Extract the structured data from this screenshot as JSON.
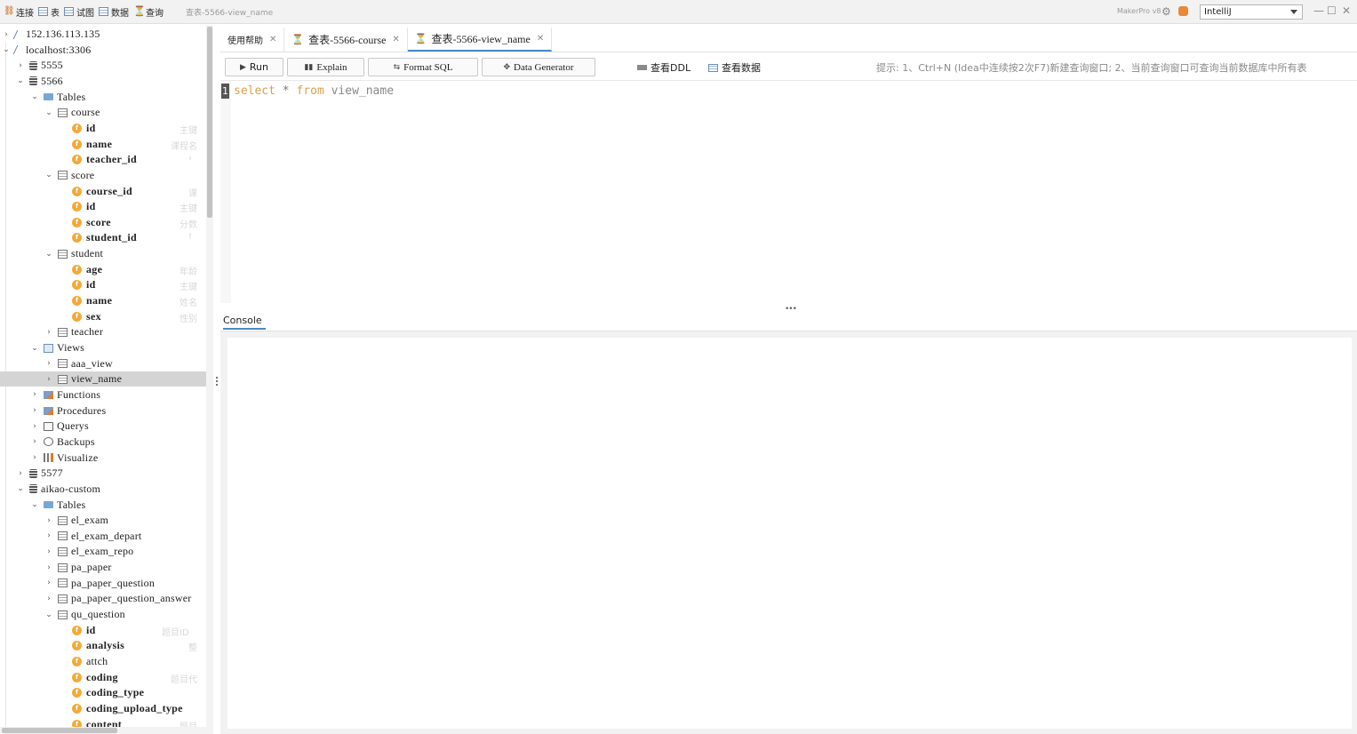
{
  "topbar": {
    "items": [
      {
        "label": "连接",
        "icon": "connect-icon"
      },
      {
        "label": "表",
        "icon": "table-icon"
      },
      {
        "label": "试图",
        "icon": "view-icon"
      },
      {
        "label": "数据",
        "icon": "data-icon"
      },
      {
        "label": "查询",
        "icon": "query-icon"
      }
    ],
    "window_title": "查表-5566-view_name",
    "brand": "MakerPro v8",
    "theme": "IntelliJ",
    "minimize": "—",
    "maximize": "☐",
    "close": "✕"
  },
  "tree": {
    "nodes": [
      {
        "depth": 0,
        "chev": "›",
        "icon": "server",
        "label": "152.136.113.135",
        "kind": "tname"
      },
      {
        "depth": 0,
        "chev": "⌄",
        "icon": "server",
        "label": "localhost:3306",
        "kind": "tname"
      },
      {
        "depth": 1,
        "chev": "›",
        "icon": "db",
        "label": "5555",
        "kind": "tname"
      },
      {
        "depth": 1,
        "chev": "⌄",
        "icon": "db",
        "label": "5566",
        "kind": "tname"
      },
      {
        "depth": 2,
        "chev": "⌄",
        "icon": "folder",
        "label": "Tables",
        "kind": "tname"
      },
      {
        "depth": 3,
        "chev": "⌄",
        "icon": "table",
        "label": "course",
        "kind": "tname"
      },
      {
        "depth": 4,
        "chev": "",
        "icon": "field",
        "label": "id",
        "kind": "fname",
        "comment": "主键"
      },
      {
        "depth": 4,
        "chev": "",
        "icon": "field",
        "label": "name",
        "kind": "fname",
        "comment": "课程名"
      },
      {
        "depth": 4,
        "chev": "",
        "icon": "field",
        "label": "teacher_id",
        "kind": "fname",
        "comment": "‹"
      },
      {
        "depth": 3,
        "chev": "⌄",
        "icon": "table",
        "label": "score",
        "kind": "tname"
      },
      {
        "depth": 4,
        "chev": "",
        "icon": "field",
        "label": "course_id",
        "kind": "fname",
        "comment": "课"
      },
      {
        "depth": 4,
        "chev": "",
        "icon": "field",
        "label": "id",
        "kind": "fname",
        "comment": "主键"
      },
      {
        "depth": 4,
        "chev": "",
        "icon": "field",
        "label": "score",
        "kind": "fname",
        "comment": "分数"
      },
      {
        "depth": 4,
        "chev": "",
        "icon": "field",
        "label": "student_id",
        "kind": "fname",
        "comment": "!"
      },
      {
        "depth": 3,
        "chev": "⌄",
        "icon": "table",
        "label": "student",
        "kind": "tname"
      },
      {
        "depth": 4,
        "chev": "",
        "icon": "field",
        "label": "age",
        "kind": "fname",
        "comment": "年龄"
      },
      {
        "depth": 4,
        "chev": "",
        "icon": "field",
        "label": "id",
        "kind": "fname",
        "comment": "主键"
      },
      {
        "depth": 4,
        "chev": "",
        "icon": "field",
        "label": "name",
        "kind": "fname",
        "comment": "姓名"
      },
      {
        "depth": 4,
        "chev": "",
        "icon": "field",
        "label": "sex",
        "kind": "fname",
        "comment": "性别"
      },
      {
        "depth": 3,
        "chev": "›",
        "icon": "table",
        "label": "teacher",
        "kind": "tname"
      },
      {
        "depth": 2,
        "chev": "⌄",
        "icon": "view",
        "label": "Views",
        "kind": "tname"
      },
      {
        "depth": 3,
        "chev": "›",
        "icon": "table",
        "label": "aaa_view",
        "kind": "tname"
      },
      {
        "depth": 3,
        "chev": "›",
        "icon": "table",
        "label": "view_name",
        "kind": "tname",
        "selected": true
      },
      {
        "depth": 2,
        "chev": "›",
        "icon": "func",
        "label": "Functions",
        "kind": "tname"
      },
      {
        "depth": 2,
        "chev": "›",
        "icon": "func",
        "label": "Procedures",
        "kind": "tname"
      },
      {
        "depth": 2,
        "chev": "›",
        "icon": "query",
        "label": "Querys",
        "kind": "tname"
      },
      {
        "depth": 2,
        "chev": "›",
        "icon": "backup",
        "label": "Backups",
        "kind": "tname"
      },
      {
        "depth": 2,
        "chev": "›",
        "icon": "vis",
        "label": "Visualize",
        "kind": "tname"
      },
      {
        "depth": 1,
        "chev": "›",
        "icon": "db",
        "label": "5577",
        "kind": "tname"
      },
      {
        "depth": 1,
        "chev": "⌄",
        "icon": "db",
        "label": "aikao-custom",
        "kind": "tname"
      },
      {
        "depth": 2,
        "chev": "⌄",
        "icon": "folder",
        "label": "Tables",
        "kind": "tname"
      },
      {
        "depth": 3,
        "chev": "›",
        "icon": "table",
        "label": "el_exam",
        "kind": "tname"
      },
      {
        "depth": 3,
        "chev": "›",
        "icon": "table",
        "label": "el_exam_depart",
        "kind": "tname"
      },
      {
        "depth": 3,
        "chev": "›",
        "icon": "table",
        "label": "el_exam_repo",
        "kind": "tname"
      },
      {
        "depth": 3,
        "chev": "›",
        "icon": "table",
        "label": "pa_paper",
        "kind": "tname"
      },
      {
        "depth": 3,
        "chev": "›",
        "icon": "table",
        "label": "pa_paper_question",
        "kind": "tname"
      },
      {
        "depth": 3,
        "chev": "›",
        "icon": "table",
        "label": "pa_paper_question_answer",
        "kind": "tname"
      },
      {
        "depth": 3,
        "chev": "⌄",
        "icon": "table",
        "label": "qu_question",
        "kind": "tname"
      },
      {
        "depth": 4,
        "chev": "",
        "icon": "field",
        "label": "id",
        "kind": "fname",
        "comment": "题目ID"
      },
      {
        "depth": 4,
        "chev": "",
        "icon": "field",
        "label": "analysis",
        "kind": "fname",
        "comment": "整"
      },
      {
        "depth": 4,
        "chev": "",
        "icon": "field",
        "label": "attch",
        "kind": "tname"
      },
      {
        "depth": 4,
        "chev": "",
        "icon": "field",
        "label": "coding",
        "kind": "fname",
        "comment": "题目代"
      },
      {
        "depth": 4,
        "chev": "",
        "icon": "field",
        "label": "coding_type",
        "kind": "fname"
      },
      {
        "depth": 4,
        "chev": "",
        "icon": "field",
        "label": "coding_upload_type",
        "kind": "fname"
      },
      {
        "depth": 4,
        "chev": "",
        "icon": "field",
        "label": "content",
        "kind": "fname",
        "comment": "题目"
      }
    ]
  },
  "tabs": [
    {
      "label": "使用帮助",
      "icon": false,
      "active": false
    },
    {
      "label": "查表-5566-course",
      "icon": true,
      "active": false
    },
    {
      "label": "查表-5566-view_name",
      "icon": true,
      "active": true
    }
  ],
  "actions": {
    "run": "Run",
    "explain": "Explain",
    "format": "Format SQL",
    "generator": "Data Generator",
    "view_ddl": "查看DDL",
    "view_data": "查看数据",
    "hint": "提示: 1、Ctrl+N (Idea中连续按2次F7)新建查询窗口; 2、当前查询窗口可查询当前数据库中所有表"
  },
  "editor": {
    "line_number": "1",
    "code": {
      "kw1": "select",
      "op": " * ",
      "kw2": "from",
      "ident": " view_name"
    }
  },
  "console": {
    "tab_label": "Console"
  }
}
